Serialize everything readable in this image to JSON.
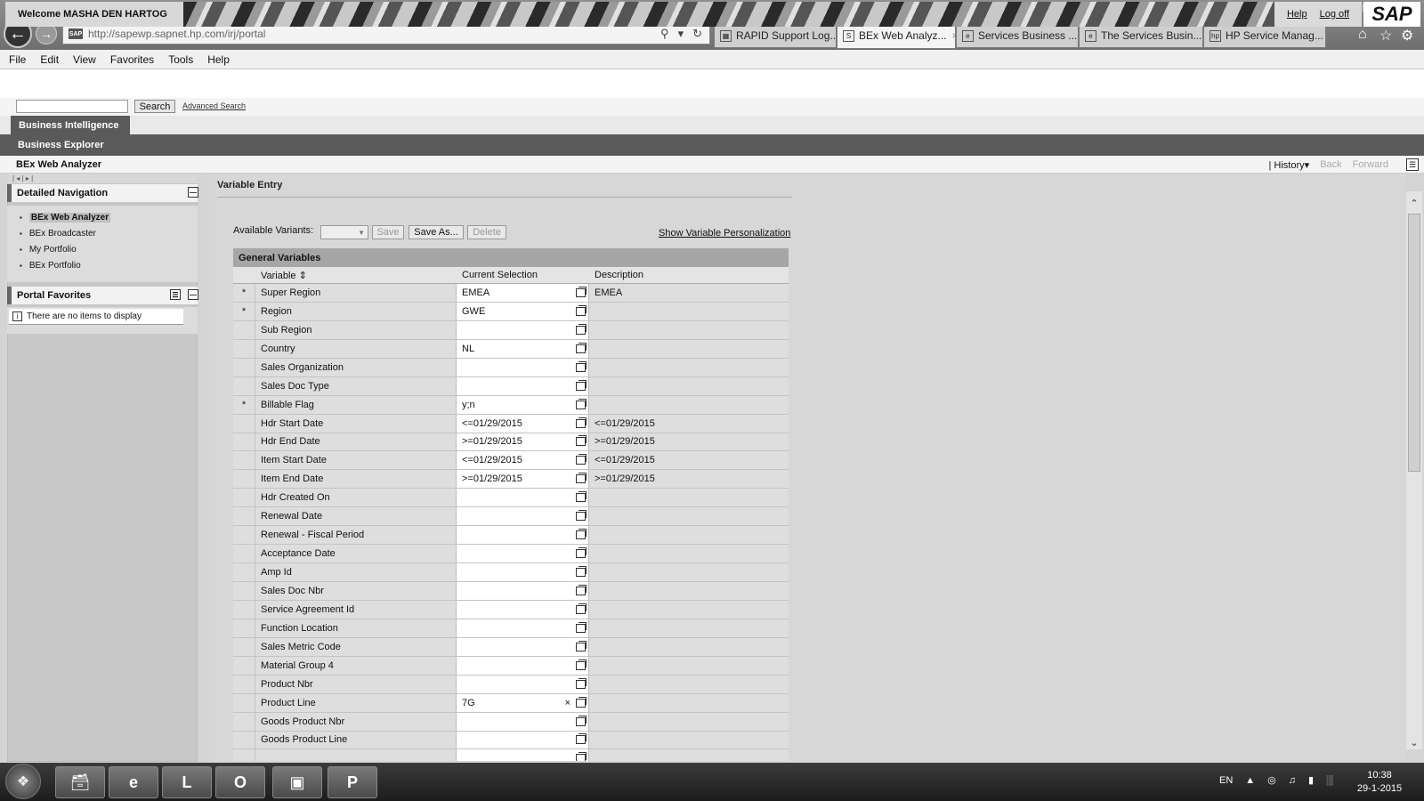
{
  "browser": {
    "url": "http://sapewp.sapnet.hp.com/irj/portal",
    "url_favicon": "SAP",
    "tabs": [
      {
        "label": "RAPID Support Log...",
        "active": false
      },
      {
        "label": "BEx Web Analyz...",
        "active": true,
        "close": "×"
      },
      {
        "label": "Services Business ...",
        "active": false
      },
      {
        "label": "The Services Busin...",
        "active": false
      },
      {
        "label": "HP Service Manag...",
        "active": false
      }
    ]
  },
  "menubar": [
    "File",
    "Edit",
    "View",
    "Favorites",
    "Tools",
    "Help"
  ],
  "header": {
    "welcome": "Welcome MASHA DEN HARTOG",
    "help": "Help",
    "logoff": "Log off",
    "logo": "SAP"
  },
  "search": {
    "button": "Search",
    "advanced": "Advanced Search"
  },
  "nav": {
    "level1": "Business Intelligence",
    "level2": "Business Explorer"
  },
  "page": {
    "title": "BEx Web Analyzer",
    "history": "History",
    "back": "Back",
    "forward": "Forward"
  },
  "detailed_navigation": {
    "title": "Detailed Navigation",
    "items": [
      {
        "label": "BEx Web Analyzer",
        "selected": true
      },
      {
        "label": "BEx Broadcaster",
        "selected": false
      },
      {
        "label": "My Portfolio",
        "selected": false
      },
      {
        "label": "BEx Portfolio",
        "selected": false
      }
    ]
  },
  "portal_favorites": {
    "title": "Portal Favorites",
    "empty": "There are no items to display"
  },
  "variable_entry": {
    "title": "Variable Entry",
    "available_variants_label": "Available Variants:",
    "buttons": {
      "save": "Save",
      "save_as": "Save As...",
      "delete": "Delete"
    },
    "show_personalization": "Show Variable Personalization",
    "section": "General Variables",
    "columns": {
      "variable": "Variable",
      "current": "Current Selection",
      "description": "Description"
    },
    "rows": [
      {
        "req": "*",
        "name": "Super Region",
        "value": "EMEA",
        "desc": "EMEA"
      },
      {
        "req": "*",
        "name": "Region",
        "value": "GWE",
        "desc": ""
      },
      {
        "req": "",
        "name": "Sub Region",
        "value": "",
        "desc": ""
      },
      {
        "req": "",
        "name": "Country",
        "value": "NL",
        "desc": ""
      },
      {
        "req": "",
        "name": "Sales Organization",
        "value": "",
        "desc": ""
      },
      {
        "req": "",
        "name": "Sales Doc Type",
        "value": "",
        "desc": ""
      },
      {
        "req": "*",
        "name": "Billable Flag",
        "value": "y;n",
        "desc": ""
      },
      {
        "req": "",
        "name": "Hdr Start Date",
        "value": "<=01/29/2015",
        "desc": "<=01/29/2015"
      },
      {
        "req": "",
        "name": "Hdr End Date",
        "value": ">=01/29/2015",
        "desc": ">=01/29/2015"
      },
      {
        "req": "",
        "name": "Item Start Date",
        "value": "<=01/29/2015",
        "desc": "<=01/29/2015"
      },
      {
        "req": "",
        "name": "Item End Date",
        "value": ">=01/29/2015",
        "desc": ">=01/29/2015"
      },
      {
        "req": "",
        "name": "Hdr Created On",
        "value": "",
        "desc": ""
      },
      {
        "req": "",
        "name": "Renewal Date",
        "value": "",
        "desc": ""
      },
      {
        "req": "",
        "name": "Renewal - Fiscal Period",
        "value": "",
        "desc": ""
      },
      {
        "req": "",
        "name": "Acceptance Date",
        "value": "",
        "desc": ""
      },
      {
        "req": "",
        "name": "Amp Id",
        "value": "",
        "desc": ""
      },
      {
        "req": "",
        "name": "Sales Doc Nbr",
        "value": "",
        "desc": ""
      },
      {
        "req": "",
        "name": "Service Agreement Id",
        "value": "",
        "desc": ""
      },
      {
        "req": "",
        "name": "Function Location",
        "value": "",
        "desc": ""
      },
      {
        "req": "",
        "name": "Sales Metric Code",
        "value": "",
        "desc": ""
      },
      {
        "req": "",
        "name": "Material Group 4",
        "value": "",
        "desc": ""
      },
      {
        "req": "",
        "name": "Product Nbr",
        "value": "",
        "desc": ""
      },
      {
        "req": "",
        "name": "Product Line",
        "value": "7G",
        "desc": "",
        "clear": "×"
      },
      {
        "req": "",
        "name": "Goods Product Nbr",
        "value": "",
        "desc": ""
      },
      {
        "req": "",
        "name": "Goods Product Line",
        "value": "",
        "desc": ""
      },
      {
        "req": "",
        "name": "",
        "value": "",
        "desc": ""
      }
    ]
  },
  "taskbar": {
    "lang": "EN",
    "time": "10:38",
    "date": "29-1-2015"
  }
}
